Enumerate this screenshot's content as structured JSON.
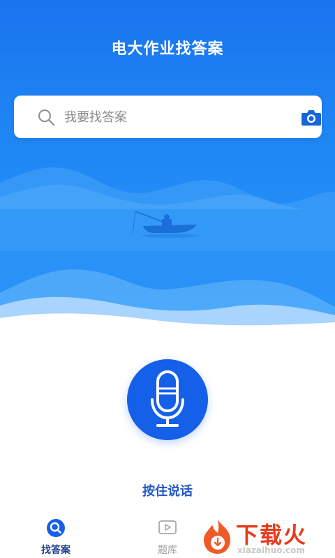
{
  "header": {
    "title": "电大作业找答案"
  },
  "search": {
    "placeholder": "我要找答案"
  },
  "voice": {
    "hold_label": "按住说话"
  },
  "tabs": [
    {
      "label": "找答案",
      "active": true
    },
    {
      "label": "题库",
      "active": false
    }
  ],
  "watermark": {
    "brand": "下载火",
    "site": "xiazaihuo.com"
  },
  "colors": {
    "primary": "#1560e8",
    "hero": "#1e86f4",
    "active_tab": "#1f3e8a",
    "inactive_tab": "#9a9a9a",
    "watermark": "#e83a1c"
  },
  "icons": [
    "search-icon",
    "camera-icon",
    "microphone-icon",
    "magnifier-tab-icon",
    "play-tab-icon",
    "flame-logo-icon"
  ]
}
